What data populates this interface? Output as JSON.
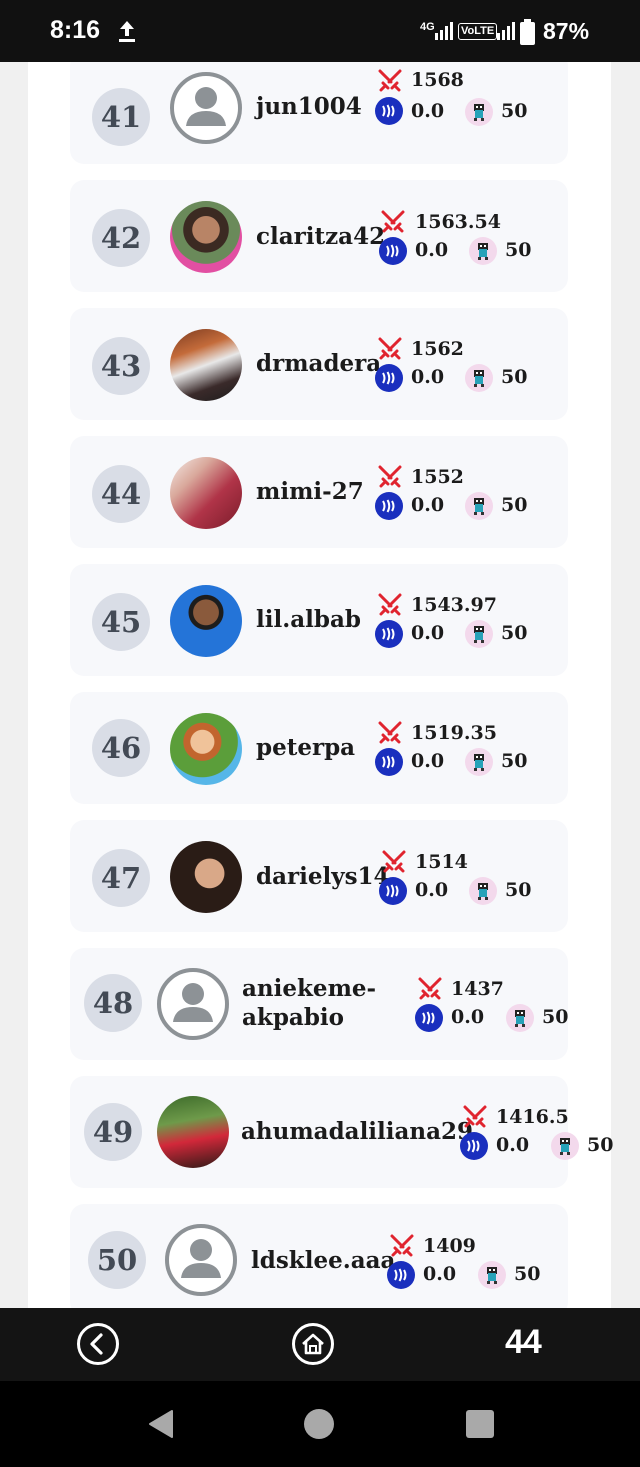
{
  "status_bar": {
    "time": "8:16",
    "network": "4G",
    "volte": "VoLTE",
    "battery": "87%",
    "icons": [
      "upload-icon",
      "signal-icon",
      "battery-icon"
    ]
  },
  "leaderboard": [
    {
      "rank": "41",
      "username": "jun1004",
      "rating": "1568",
      "steem": "0.0",
      "power": "50",
      "avatar": "default"
    },
    {
      "rank": "42",
      "username": "claritza42",
      "rating": "1563.54",
      "steem": "0.0",
      "power": "50",
      "avatar": "photo"
    },
    {
      "rank": "43",
      "username": "drmadera",
      "rating": "1562",
      "steem": "0.0",
      "power": "50",
      "avatar": "photo"
    },
    {
      "rank": "44",
      "username": "mimi-27",
      "rating": "1552",
      "steem": "0.0",
      "power": "50",
      "avatar": "photo"
    },
    {
      "rank": "45",
      "username": "lil.albab",
      "rating": "1543.97",
      "steem": "0.0",
      "power": "50",
      "avatar": "photo"
    },
    {
      "rank": "46",
      "username": "peterpa",
      "rating": "1519.35",
      "steem": "0.0",
      "power": "50",
      "avatar": "photo"
    },
    {
      "rank": "47",
      "username": "darielys14",
      "rating": "1514",
      "steem": "0.0",
      "power": "50",
      "avatar": "photo"
    },
    {
      "rank": "48",
      "username": "aniekeme-akpabio",
      "username_lines": [
        "aniekeme-",
        "akpabio"
      ],
      "rating": "1437",
      "steem": "0.0",
      "power": "50",
      "avatar": "default"
    },
    {
      "rank": "49",
      "username": "ahumadaliliana29",
      "rating": "1416.5",
      "steem": "0.0",
      "power": "50",
      "avatar": "photo"
    },
    {
      "rank": "50",
      "username": "ldsklee.aaa",
      "rating": "1409",
      "steem": "0.0",
      "power": "50",
      "avatar": "default"
    }
  ],
  "row_icons": [
    "swords-icon",
    "steem-icon",
    "monster-icon"
  ],
  "app_nav": {
    "back": "back-icon",
    "home": "home-icon",
    "logo": "44",
    "logo_icon": "app-logo-icon"
  },
  "system_nav": [
    "back-triangle-icon",
    "home-circle-icon",
    "recents-square-icon"
  ],
  "colors": {
    "row_bg": "#f7f8fb",
    "rank_badge": "#d9dde6",
    "swords": "#e0242f",
    "steem": "#1a2fbe",
    "nav_bar": "#141414"
  }
}
